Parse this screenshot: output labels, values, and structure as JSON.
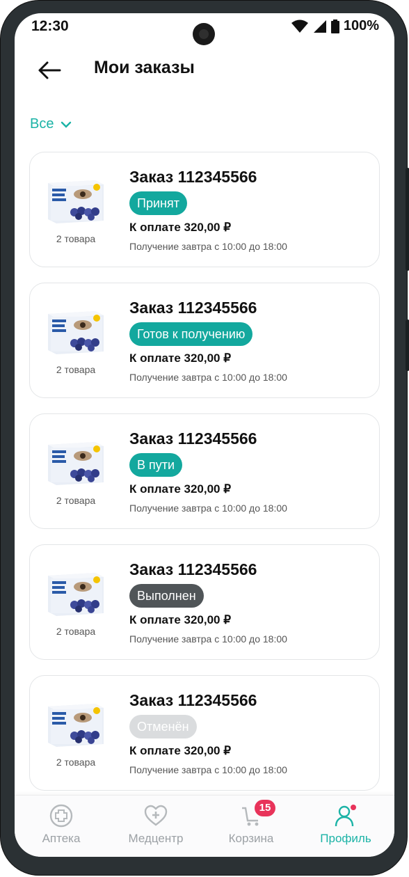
{
  "status_bar": {
    "time": "12:30",
    "battery": "100%"
  },
  "header": {
    "title": "Мои заказы"
  },
  "filter": {
    "label": "Все"
  },
  "orders": [
    {
      "title": "Заказ 112345566",
      "status": "Принят",
      "status_color": "#13a89e",
      "amount": "К оплате 320,00 ₽",
      "delivery": "Получение завтра с 10:00 до 18:00",
      "items_count": "2 товара"
    },
    {
      "title": "Заказ 112345566",
      "status": "Готов к получению",
      "status_color": "#13a89e",
      "amount": "К оплате 320,00 ₽",
      "delivery": "Получение завтра с 10:00 до 18:00",
      "items_count": "2 товара"
    },
    {
      "title": "Заказ 112345566",
      "status": "В пути",
      "status_color": "#13a89e",
      "amount": "К оплате 320,00 ₽",
      "delivery": "Получение завтра с 10:00 до 18:00",
      "items_count": "2 товара"
    },
    {
      "title": "Заказ 112345566",
      "status": "Выполнен",
      "status_color": "#505558",
      "amount": "К оплате 320,00 ₽",
      "delivery": "Получение завтра с 10:00 до 18:00",
      "items_count": "2 товара"
    },
    {
      "title": "Заказ 112345566",
      "status": "Отменён",
      "status_color": "#dadcde",
      "amount": "К оплате 320,00 ₽",
      "delivery": "Получение завтра с 10:00 до 18:00",
      "items_count": "2 товара"
    }
  ],
  "tabbar": {
    "items": [
      {
        "label": "Аптека",
        "icon": "pharmacy-cross-icon"
      },
      {
        "label": "Медцентр",
        "icon": "heart-plus-icon"
      },
      {
        "label": "Корзина",
        "icon": "cart-icon",
        "badge": "15"
      },
      {
        "label": "Профиль",
        "icon": "profile-icon",
        "active": true
      }
    ]
  },
  "colors": {
    "accent": "#1bb3a6",
    "badge_red": "#e8335a"
  }
}
